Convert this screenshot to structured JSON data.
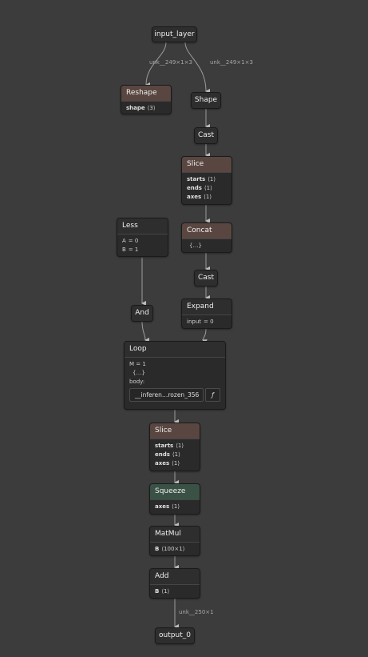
{
  "edges": {
    "input_left": "unk__249×1×3",
    "input_right": "unk__249×1×3",
    "output": "unk__250×1"
  },
  "nodes": {
    "input_layer": {
      "title": "input_layer"
    },
    "reshape": {
      "title": "Reshape",
      "attrs": [
        {
          "key": "shape",
          "value": "⟨3⟩"
        }
      ]
    },
    "shape": {
      "title": "Shape"
    },
    "cast1": {
      "title": "Cast"
    },
    "slice1": {
      "title": "Slice",
      "attrs": [
        {
          "key": "starts",
          "value": "⟨1⟩"
        },
        {
          "key": "ends",
          "value": "⟨1⟩"
        },
        {
          "key": "axes",
          "value": "⟨1⟩"
        }
      ]
    },
    "less": {
      "title": "Less",
      "attrs": [
        {
          "key": "A",
          "value": "= 0"
        },
        {
          "key": "B",
          "value": "= 1"
        }
      ]
    },
    "concat": {
      "title": "Concat",
      "content": "{…}"
    },
    "cast2": {
      "title": "Cast"
    },
    "and": {
      "title": "And"
    },
    "expand": {
      "title": "Expand",
      "attrs": [
        {
          "key": "input",
          "value": "= 0"
        }
      ]
    },
    "loop": {
      "title": "Loop",
      "m": "M = 1",
      "content": "{…}",
      "body_label": "body:",
      "subgraph": "__inferen…rozen_356",
      "fn": "ƒ"
    },
    "slice2": {
      "title": "Slice",
      "attrs": [
        {
          "key": "starts",
          "value": "⟨1⟩"
        },
        {
          "key": "ends",
          "value": "⟨1⟩"
        },
        {
          "key": "axes",
          "value": "⟨1⟩"
        }
      ]
    },
    "squeeze": {
      "title": "Squeeze",
      "attrs": [
        {
          "key": "axes",
          "value": "⟨1⟩"
        }
      ]
    },
    "matmul": {
      "title": "MatMul",
      "attrs": [
        {
          "key": "B",
          "value": "⟨100×1⟩"
        }
      ]
    },
    "add": {
      "title": "Add",
      "attrs": [
        {
          "key": "B",
          "value": "⟨1⟩"
        }
      ]
    },
    "output_0": {
      "title": "output_0"
    }
  }
}
